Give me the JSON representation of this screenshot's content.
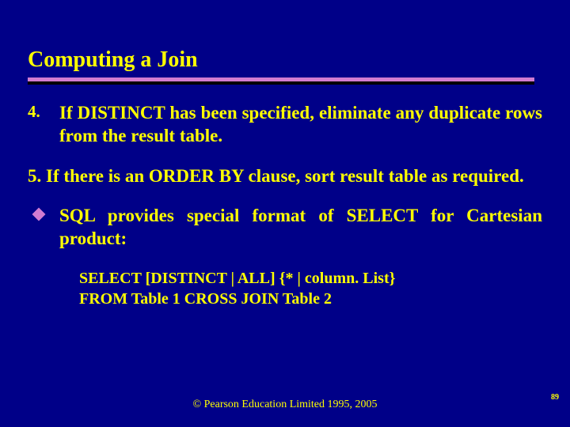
{
  "title": "Computing a Join",
  "item4_num": "4.",
  "item4_text": "If DISTINCT has been specified, eliminate any duplicate rows from the result table.",
  "item5_text": "5. If there is an ORDER BY clause, sort result table as required.",
  "itemU_text": "SQL provides special format of SELECT for Cartesian product:",
  "code_line1": "SELECT   [DISTINCT | ALL]   {* | column. List}",
  "code_line2": "FROM Table 1 CROSS JOIN Table 2",
  "footer": "© Pearson Education Limited 1995, 2005",
  "page_num": "89"
}
